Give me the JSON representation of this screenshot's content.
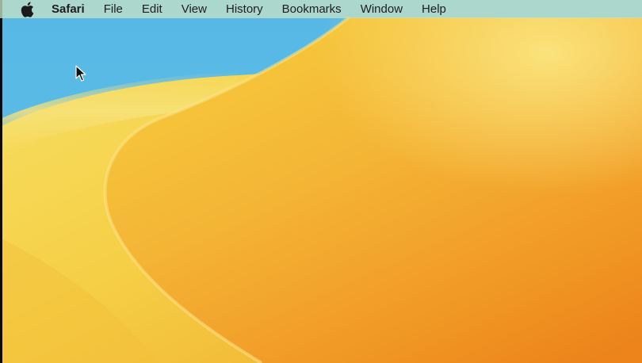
{
  "menubar": {
    "apple_icon": "apple-logo-icon",
    "app_name": "Safari",
    "items": [
      {
        "label": "File"
      },
      {
        "label": "Edit"
      },
      {
        "label": "View"
      },
      {
        "label": "History"
      },
      {
        "label": "Bookmarks"
      },
      {
        "label": "Window"
      },
      {
        "label": "Help"
      }
    ]
  },
  "desktop": {
    "wallpaper": "macos-ventura-dune",
    "colors": {
      "sky": "#52b6e3",
      "sand_light": "#f5d24a",
      "sand_mid": "#f4b433",
      "sand_dark": "#ec8a1e"
    }
  },
  "cursor": {
    "icon": "arrow-cursor-icon"
  }
}
